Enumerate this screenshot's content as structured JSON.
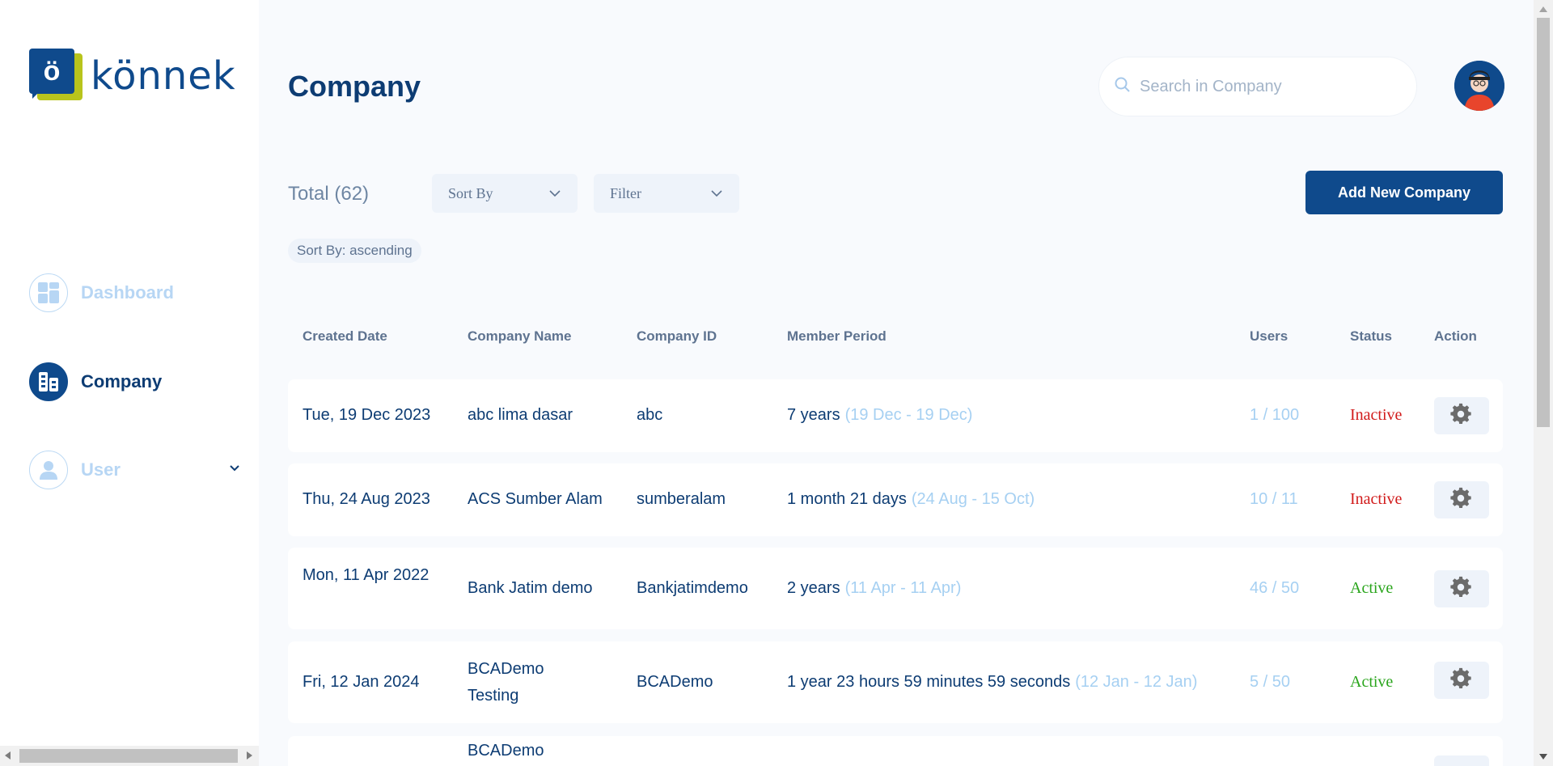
{
  "brand": {
    "logo_letter": "ö",
    "name": "könnek"
  },
  "sidebar": {
    "items": [
      {
        "label": "Dashboard"
      },
      {
        "label": "Company"
      },
      {
        "label": "User"
      }
    ]
  },
  "header": {
    "title": "Company",
    "search_placeholder": "Search in Company"
  },
  "toolbar": {
    "total": "Total (62)",
    "sort_label": "Sort By",
    "filter_label": "Filter",
    "add_label": "Add New Company",
    "sort_chip": "Sort By: ascending"
  },
  "table": {
    "columns": [
      "Created Date",
      "Company Name",
      "Company ID",
      "Member Period",
      "Users",
      "Status",
      "Action"
    ],
    "rows": [
      {
        "date": "Tue, 19 Dec 2023",
        "name": "abc lima dasar",
        "id": "abc",
        "period": "7 years",
        "range": "(19 Dec - 19 Dec)",
        "users": "1 / 100",
        "status": "Inactive"
      },
      {
        "date": "Thu, 24 Aug 2023",
        "name": "ACS Sumber Alam",
        "id": "sumberalam",
        "period": "1 month 21 days",
        "range": "(24 Aug - 15 Oct)",
        "users": "10 / 11",
        "status": "Inactive"
      },
      {
        "date": "Mon, 11 Apr 2022",
        "name": "Bank Jatim demo",
        "id": "Bankjatimdemo",
        "period": "2 years",
        "range": "(11 Apr - 11 Apr)",
        "users": "46 / 50",
        "status": "Active"
      },
      {
        "date": "Fri, 12 Jan 2024",
        "name": "BCADemo Testing",
        "id": "BCADemo",
        "period": "1 year 23 hours 59 minutes 59 seconds",
        "range": "(12 Jan - 12 Jan)",
        "users": "5 / 50",
        "status": "Active"
      },
      {
        "date": "",
        "name": "BCADemo",
        "id": "",
        "period": "",
        "range": "",
        "users": "",
        "status": ""
      }
    ]
  },
  "colors": {
    "primary": "#0f4a8c",
    "text": "#0d3c73",
    "muted": "#a6d0f2",
    "inactive": "#d11b1b",
    "active": "#2aa51c",
    "logo_accent": "#b8c41c"
  }
}
